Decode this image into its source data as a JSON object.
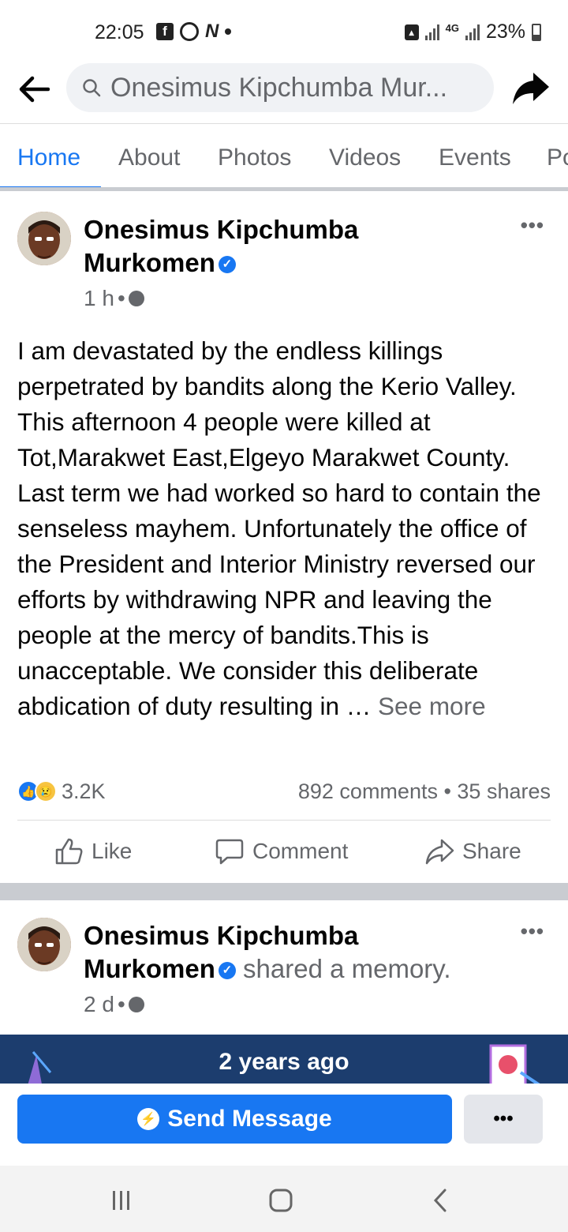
{
  "status_bar": {
    "time": "22:05",
    "app_icons": [
      "facebook-icon",
      "whatsapp-icon",
      "n-app-icon"
    ],
    "network": "4G",
    "battery": "23%"
  },
  "search": {
    "value": "Onesimus Kipchumba Mur..."
  },
  "tabs": [
    "Home",
    "About",
    "Photos",
    "Videos",
    "Events",
    "Po"
  ],
  "posts": [
    {
      "author_line1": "Onesimus Kipchumba",
      "author_line2": "Murkomen",
      "time": "1 h",
      "text": "I am devastated by the endless killings perpetrated by bandits along the  Kerio Valley. This afternoon 4 people were killed at Tot,Marakwet East,Elgeyo Marakwet County. Last term we had worked so hard to contain the senseless mayhem. Unfortunately the office of the President and Interior Ministry reversed our efforts by withdrawing NPR and leaving the people at the mercy of bandits.This is unacceptable. We consider this deliberate abdication of duty resulting in … ",
      "see_more": "See more",
      "reactions_count": "3.2K",
      "comments_shares": "892 comments • 35 shares",
      "actions": {
        "like": "Like",
        "comment": "Comment",
        "share": "Share"
      }
    },
    {
      "author_line1": "Onesimus Kipchumba",
      "author_line2": "Murkomen",
      "activity": " shared a memory.",
      "time": "2 d",
      "memory_label": "2 years ago"
    }
  ],
  "cta": {
    "send_message": "Send Message",
    "more": "•••"
  },
  "colors": {
    "accent": "#1877f2",
    "secondary_text": "#65676b",
    "memory_banner": "#1c3d6e"
  }
}
